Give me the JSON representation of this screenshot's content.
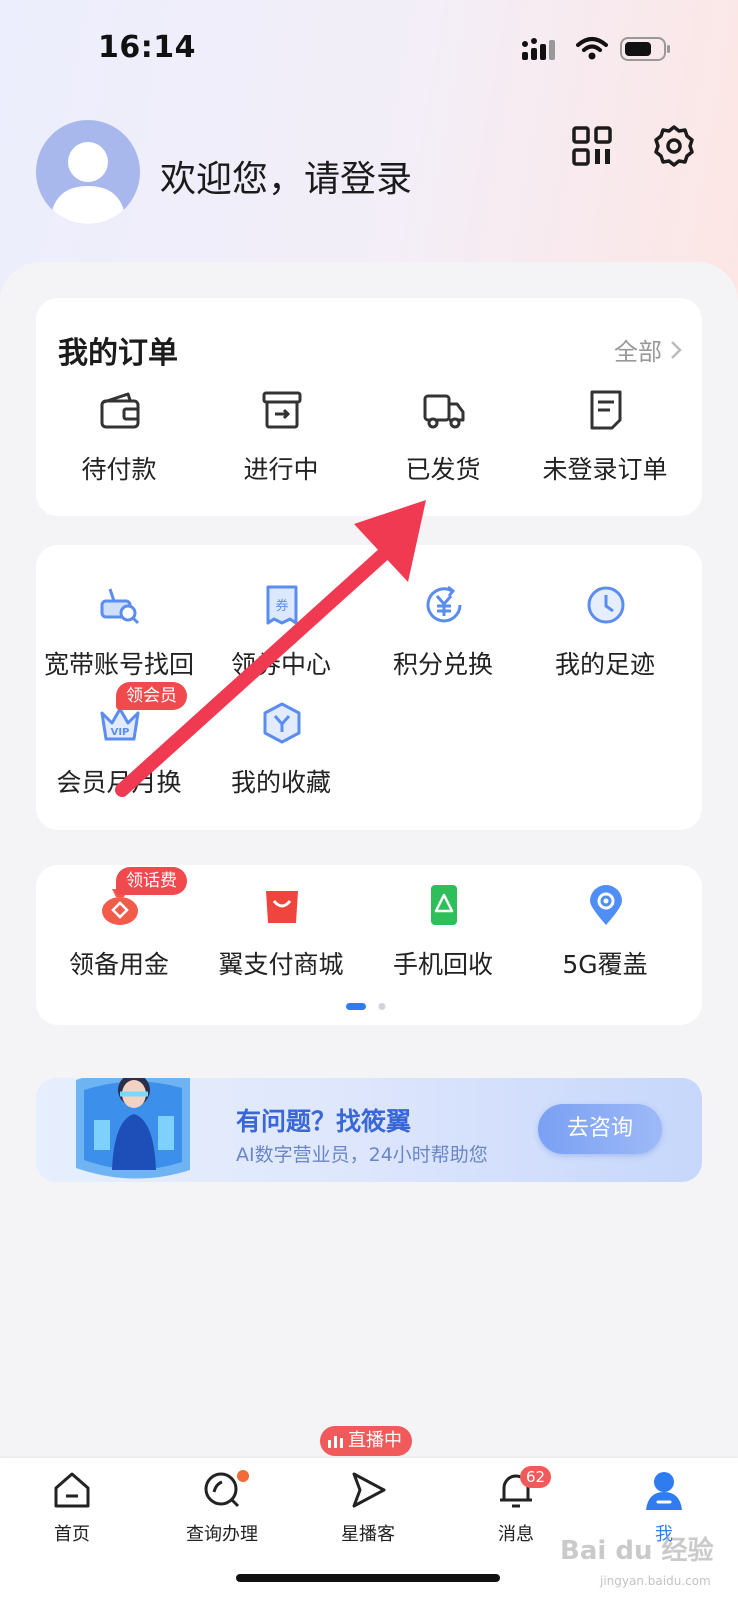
{
  "status_bar": {
    "time": "16:14"
  },
  "header": {
    "welcome": "欢迎您，请登录",
    "qr_icon": "qr-code-icon",
    "settings_icon": "gear-icon"
  },
  "orders": {
    "title": "我的订单",
    "all_label": "全部",
    "items": [
      {
        "label": "待付款",
        "icon": "wallet-icon"
      },
      {
        "label": "进行中",
        "icon": "box-arrow-icon"
      },
      {
        "label": "已发货",
        "icon": "truck-icon"
      },
      {
        "label": "未登录订单",
        "icon": "document-icon"
      }
    ]
  },
  "services": {
    "items": [
      {
        "label": "宽带账号找回",
        "icon": "router-search-icon"
      },
      {
        "label": "领券中心",
        "icon": "coupon-icon"
      },
      {
        "label": "积分兑换",
        "icon": "yuan-exchange-icon"
      },
      {
        "label": "我的足迹",
        "icon": "clock-icon"
      },
      {
        "label": "会员月月换",
        "icon": "vip-crown-icon",
        "tag": "领会员"
      },
      {
        "label": "我的收藏",
        "icon": "favorite-hexagon-icon"
      }
    ]
  },
  "promo": {
    "items": [
      {
        "label": "领备用金",
        "icon": "red-pouch-icon",
        "tag": "领话费"
      },
      {
        "label": "翼支付商城",
        "icon": "shopping-bag-icon"
      },
      {
        "label": "手机回收",
        "icon": "phone-recycle-icon"
      },
      {
        "label": "5G覆盖",
        "icon": "location-pin-icon"
      }
    ],
    "page": 1,
    "page_count": 2
  },
  "banner": {
    "title": "有问题？找筱翼",
    "subtitle": "AI数字营业员，24小时帮助您",
    "button": "去咨询"
  },
  "tabbar": {
    "live_badge": "直播中",
    "message_count": "62",
    "items": [
      {
        "label": "首页",
        "icon": "home-icon"
      },
      {
        "label": "查询办理",
        "icon": "search-icon"
      },
      {
        "label": "星播客",
        "icon": "play-icon"
      },
      {
        "label": "消息",
        "icon": "bell-icon"
      },
      {
        "label": "我",
        "icon": "person-icon",
        "active": true
      }
    ]
  },
  "watermark": {
    "text": "Bai du 经验",
    "sub": "jingyan.baidu.com"
  },
  "colors": {
    "accent": "#3d7bf0",
    "badge_red": "#f04a4f",
    "icon_blue": "#5b8cf0",
    "arrow_red": "#f03a52"
  }
}
